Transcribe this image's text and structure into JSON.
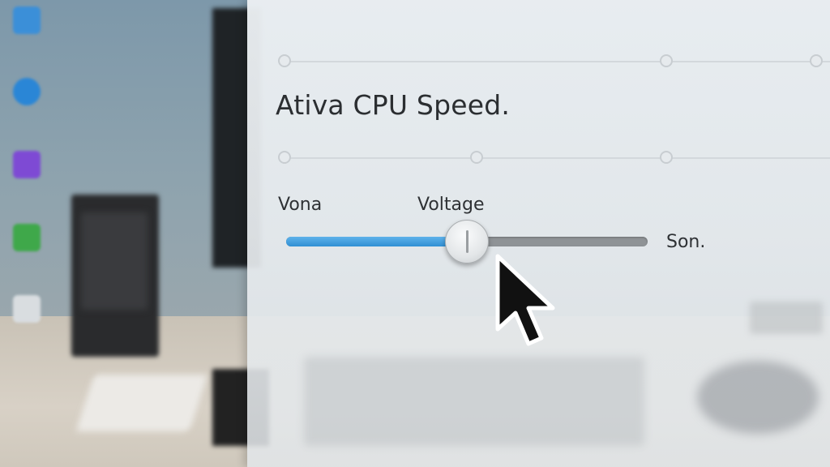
{
  "settings": {
    "title": "Ativa CPU Speed.",
    "slider": {
      "min_label": "Vona",
      "name_label": "Voltage",
      "max_label": "Son.",
      "value": 0.5
    }
  },
  "desktop_icons": [
    {
      "icon": "computer-icon",
      "color": "#3b8fd8"
    },
    {
      "icon": "browser-icon",
      "color": "#2a86d6"
    },
    {
      "icon": "app-icon",
      "color": "#7e4ad4"
    },
    {
      "icon": "folder-icon",
      "color": "#3fa84a"
    },
    {
      "icon": "document-icon",
      "color": "#d9dde0"
    }
  ],
  "colors": {
    "accent": "#2f8fd4",
    "track": "#8f9396",
    "text": "#2b2e31"
  }
}
